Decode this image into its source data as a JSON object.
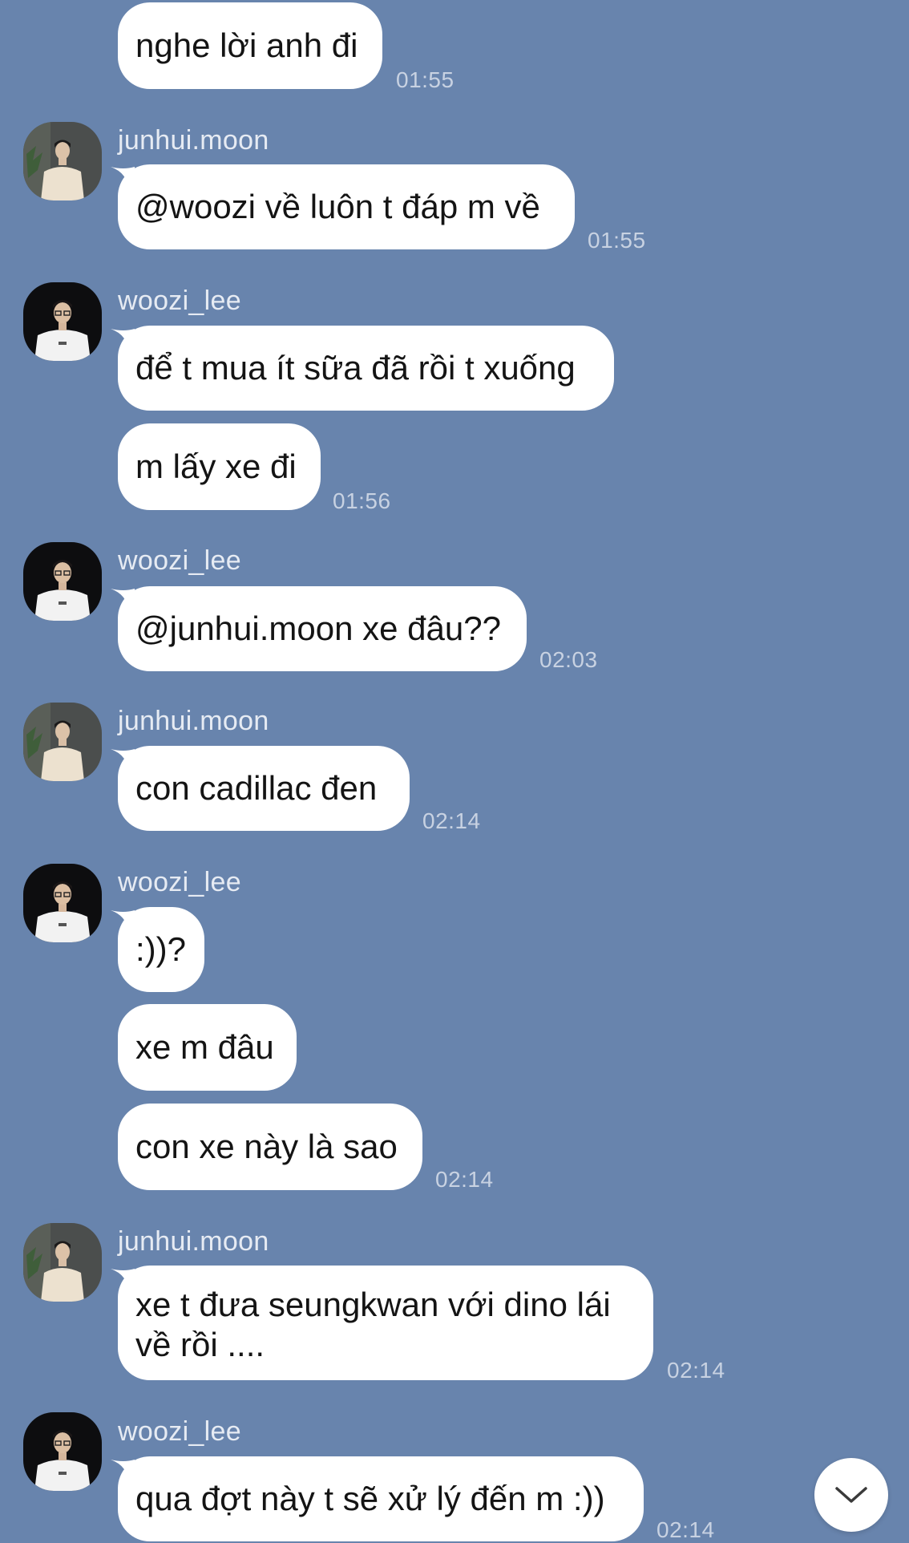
{
  "messages": [
    {
      "text": "nghe lời anh đi",
      "time": "01:55"
    },
    {
      "sender": "junhui.moon",
      "text": "@woozi về luôn t đáp m về",
      "time": "01:55"
    },
    {
      "sender": "woozi_lee",
      "text": "để t mua ít sữa đã rồi t xuống"
    },
    {
      "text": "m lấy xe đi",
      "time": "01:56"
    },
    {
      "sender": "woozi_lee",
      "text": "@junhui.moon xe đâu??",
      "time": "02:03"
    },
    {
      "sender": "junhui.moon",
      "text": "con cadillac đen",
      "time": "02:14"
    },
    {
      "sender": "woozi_lee",
      "text": ":))?"
    },
    {
      "text": "xe m đâu"
    },
    {
      "text": "con xe này là sao",
      "time": "02:14"
    },
    {
      "sender": "junhui.moon",
      "text": "xe t đưa seungkwan với dino lái về rồi ....",
      "time": "02:14"
    },
    {
      "sender": "woozi_lee",
      "text": "qua đợt này t sẽ xử lý đến m :))",
      "time": "02:14"
    }
  ],
  "icons": {
    "avatar_junhui": "avatar-photo-man-cream-shirt",
    "avatar_woozi": "avatar-photo-man-glasses-white-tshirt",
    "scroll_down": "chevron-down-icon"
  },
  "colors": {
    "background": "#6884ad",
    "bubble": "#ffffff",
    "sender_text": "#e6ebf3",
    "time_text": "#c8d2e2"
  }
}
